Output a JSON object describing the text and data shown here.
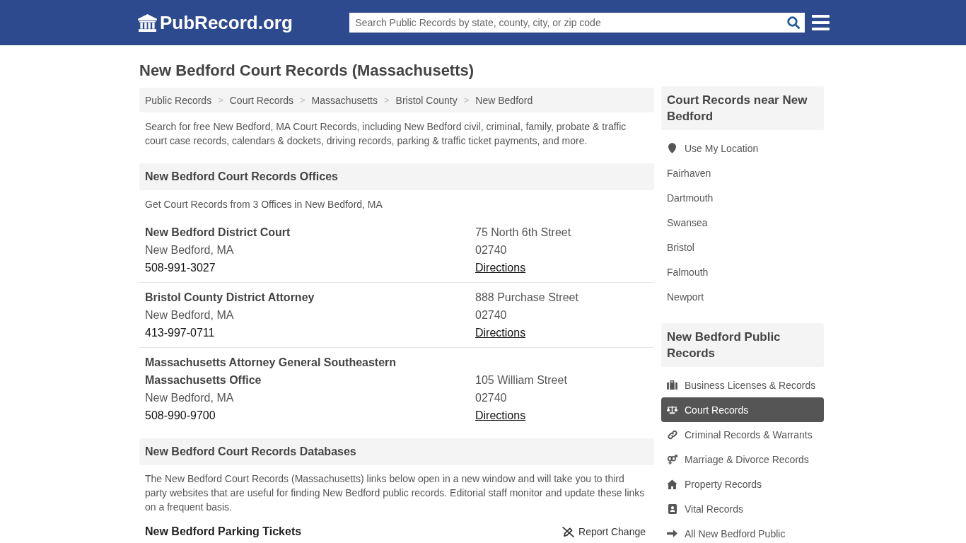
{
  "header": {
    "logo": "PubRecord.org",
    "search": {
      "placeholder": "Search Public Records by state, county, city, or zip code"
    }
  },
  "page_title": "New Bedford Court Records (Massachusetts)",
  "breadcrumb": [
    {
      "label": "Public Records",
      "separator": ">"
    },
    {
      "label": "Court Records",
      "separator": ">"
    },
    {
      "label": "Massachusetts",
      "separator": ">"
    },
    {
      "label": "Bristol County",
      "separator": ">"
    },
    {
      "label": "New Bedford"
    }
  ],
  "intro": "Search for free New Bedford, MA Court Records, including New Bedford civil, criminal, family, probate & traffic court case records, calendars & dockets, driving records, parking & traffic ticket payments, and more.",
  "offices_section": {
    "title": "New Bedford Court Records Offices",
    "summary": "Get Court Records from 3 Offices in New Bedford, MA",
    "offices": [
      {
        "name": "New Bedford District Court",
        "city": "New Bedford, MA",
        "phone": "508-991-3027",
        "address": "75 North 6th Street",
        "zip": "02740",
        "directions": "Directions"
      },
      {
        "name": "Bristol County District Attorney",
        "city": "New Bedford, MA",
        "phone": "413-997-0711",
        "address": "888 Purchase Street",
        "zip": "02740",
        "directions": "Directions"
      },
      {
        "name": "Massachusetts Attorney General Southeastern Massachusetts Office",
        "city": "New Bedford, MA",
        "phone": "508-990-9700",
        "address": "105 William Street",
        "zip": "02740",
        "directions": "Directions"
      }
    ]
  },
  "databases_section": {
    "title": "New Bedford Court Records Databases",
    "description": "The New Bedford Court Records (Massachusetts) links below open in a new window and will take you to third party websites that are useful for finding New Bedford public records. Editorial staff monitor and update these links on a frequent basis.",
    "entries": [
      {
        "name": "New Bedford Parking Tickets",
        "report": "Report Change"
      }
    ]
  },
  "sidebar": {
    "nearby": {
      "title": "Court Records near New Bedford",
      "items": [
        {
          "kind": "location",
          "label": "Use My Location"
        },
        {
          "kind": "city",
          "label": "Fairhaven"
        },
        {
          "kind": "city",
          "label": "Dartmouth"
        },
        {
          "kind": "city",
          "label": "Swansea"
        },
        {
          "kind": "city",
          "label": "Bristol"
        },
        {
          "kind": "city",
          "label": "Falmouth"
        },
        {
          "kind": "city",
          "label": "Newport"
        }
      ]
    },
    "public_records": {
      "title": "New Bedford Public Records",
      "items": [
        {
          "kind": "business",
          "label": "Business Licenses & Records",
          "selected": false
        },
        {
          "kind": "court",
          "label": "Court Records",
          "selected": true
        },
        {
          "kind": "criminal",
          "label": "Criminal Records & Warrants",
          "selected": false
        },
        {
          "kind": "marriage",
          "label": "Marriage & Divorce Records",
          "selected": false
        },
        {
          "kind": "property",
          "label": "Property Records",
          "selected": false
        },
        {
          "kind": "vital",
          "label": "Vital Records",
          "selected": false
        },
        {
          "kind": "all",
          "label": "All New Bedford Public",
          "selected": false
        }
      ]
    }
  }
}
